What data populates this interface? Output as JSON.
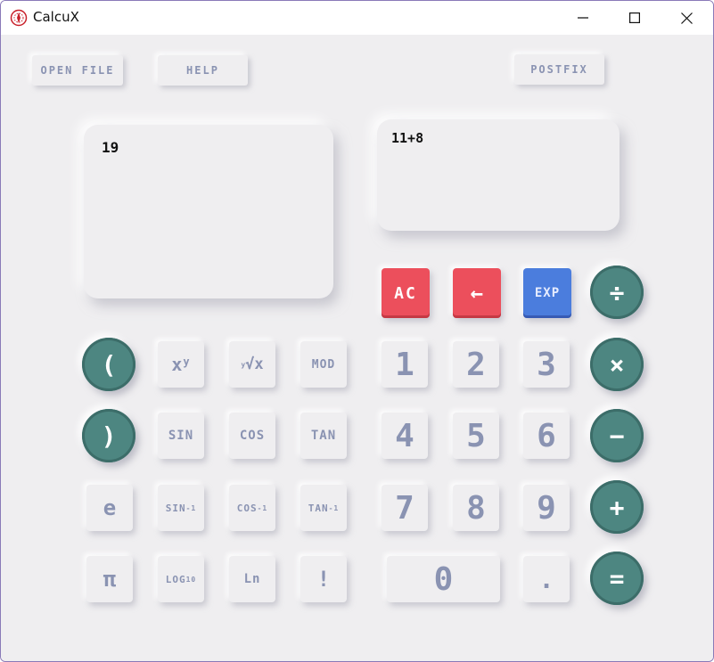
{
  "window": {
    "title": "CalcuX"
  },
  "toolbar": {
    "open_file": "OPEN FILE",
    "help": "HELP",
    "postfix": "POSTFIX"
  },
  "display": {
    "result": "19",
    "expression": "11+8"
  },
  "keys": {
    "ac": "AC",
    "backspace": "←",
    "exp": "EXP",
    "divide": "÷",
    "multiply": "×",
    "minus": "−",
    "plus": "+",
    "equals": "=",
    "open_paren": "(",
    "close_paren": ")",
    "power_base": "x",
    "power_sup": "y",
    "root_sup": "y",
    "root_main": "√x",
    "mod": "MOD",
    "sin": "SIN",
    "cos": "COS",
    "tan": "TAN",
    "e": "e",
    "asin": "SIN",
    "acos": "COS",
    "atan": "TAN",
    "inverse_sup": "-1",
    "pi": "π",
    "log": "LOG",
    "log_sub": "10",
    "ln": "Ln",
    "factorial": "!",
    "d1": "1",
    "d2": "2",
    "d3": "3",
    "d4": "4",
    "d5": "5",
    "d6": "6",
    "d7": "7",
    "d8": "8",
    "d9": "9",
    "d0": "0",
    "dot": "."
  },
  "colors": {
    "teal": "#4d8681",
    "red": "#ec4f5c",
    "blue": "#4b7ddd",
    "key_text": "#8a93b2",
    "background": "#efeef0"
  },
  "icons": {
    "app": "calculator-logo-icon",
    "minimize": "minimize-icon",
    "maximize": "maximize-icon",
    "close": "close-icon"
  }
}
